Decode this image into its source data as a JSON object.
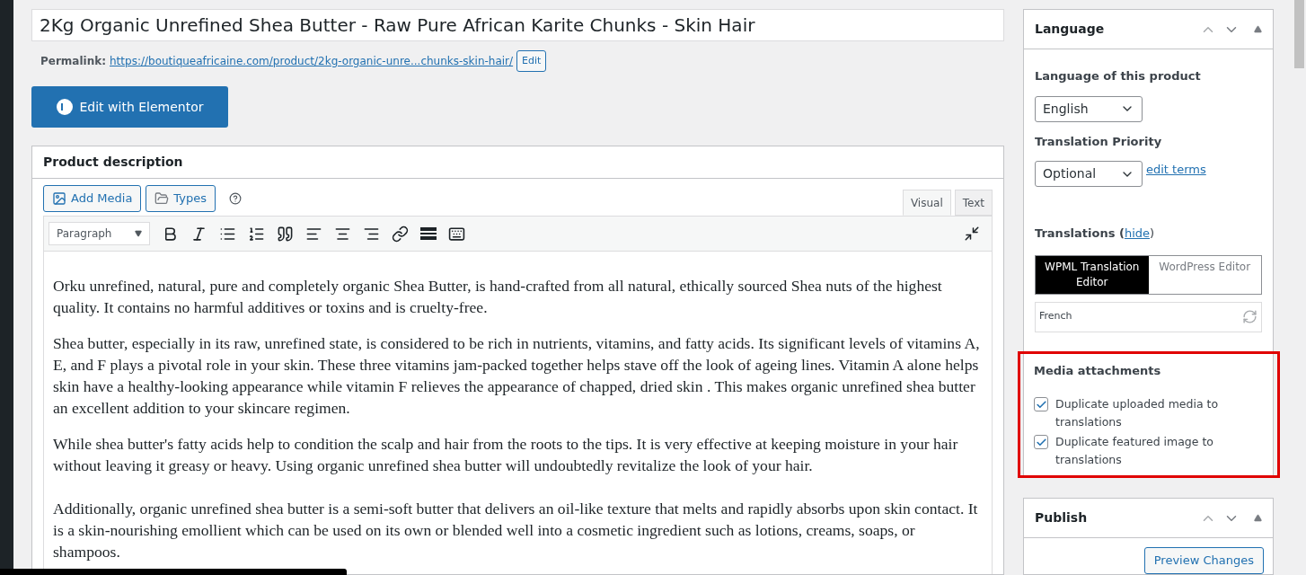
{
  "title_field": {
    "value": "2Kg Organic Unrefined Shea Butter - Raw Pure African Karite Chunks - Skin Hair"
  },
  "permalink": {
    "label": "Permalink:",
    "url": "https://boutiqueafricaine.com/product/2kg-organic-unre...chunks-skin-hair/",
    "edit_button": "Edit"
  },
  "elementor_button": "Edit with Elementor",
  "description_box": {
    "title": "Product description",
    "media_buttons": [
      {
        "label": "Add Media",
        "kind": "media"
      },
      {
        "label": "Types",
        "kind": "types"
      }
    ],
    "editor_tabs": [
      {
        "label": "Visual",
        "selected": true
      },
      {
        "label": "Text",
        "selected": false
      }
    ],
    "format_select": "Paragraph",
    "paragraphs": [
      "Orku unrefined, natural, pure and completely organic Shea Butter, is hand-crafted from all natural, ethically sourced Shea nuts of the highest quality. It contains no harmful additives or toxins and is cruelty-free.",
      "Shea butter, especially in its raw, unrefined state, is considered to be rich in nutrients, vitamins, and fatty acids. Its significant levels of vitamins A, E, and F plays a pivotal role in your skin. These three vitamins jam-packed together helps stave off the look of ageing lines. Vitamin A alone helps skin have a healthy-looking appearance while vitamin F relieves the appearance of chapped, dried skin . This makes organic unrefined shea butter an excellent addition to your skincare regimen.",
      "While shea butter's fatty acids help to condition the scalp and hair from the roots to the tips. It is very effective at keeping moisture in your hair without leaving it greasy or heavy. Using organic unrefined shea butter will undoubtedly revitalize the look of your hair.",
      "Additionally, organic unrefined shea butter is a semi-soft butter that delivers an oil-like texture that melts and rapidly absorbs upon skin contact. It is a skin-nourishing emollient which can be used on its own or blended well into a cosmetic ingredient such as lotions, creams, soaps, or shampoos."
    ]
  },
  "language_box": {
    "title": "Language",
    "language_label": "Language of this product",
    "language_value": "English",
    "priority_label": "Translation Priority",
    "priority_value": "Optional",
    "edit_terms": "edit terms",
    "translations_label": "Translations (",
    "hide_link": "hide",
    "translations_close": ")",
    "editor_options": [
      {
        "label": "WPML Translation Editor",
        "selected": true
      },
      {
        "label": "WordPress Editor",
        "selected": false
      }
    ],
    "translation_language": "French",
    "media_title": "Media attachments",
    "media_options": [
      {
        "label": "Duplicate uploaded media to translations",
        "checked": true
      },
      {
        "label": "Duplicate featured image to translations",
        "checked": true
      }
    ]
  },
  "publish_box": {
    "title": "Publish",
    "preview_button": "Preview Changes"
  }
}
